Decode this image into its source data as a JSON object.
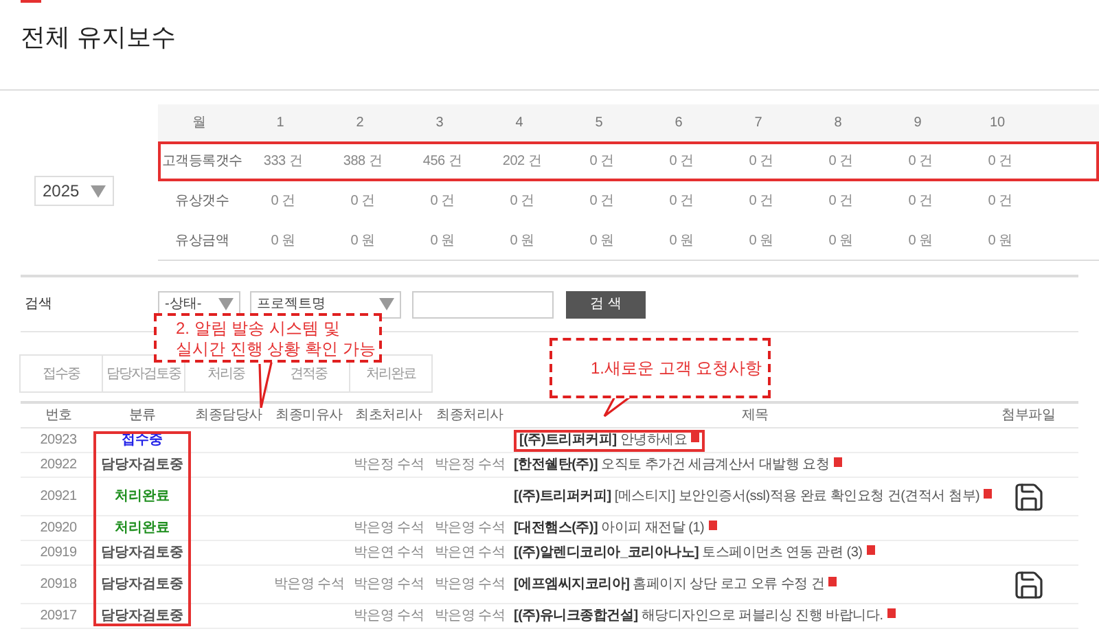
{
  "page_title": "전체 유지보수",
  "year_select": {
    "value": "2025"
  },
  "stats": {
    "header": [
      "월",
      "1",
      "2",
      "3",
      "4",
      "5",
      "6",
      "7",
      "8",
      "9",
      "10"
    ],
    "rows": [
      {
        "label": "고객등록갯수",
        "values": [
          "333 건",
          "388 건",
          "456 건",
          "202 건",
          "0 건",
          "0 건",
          "0 건",
          "0 건",
          "0 건",
          "0 건"
        ],
        "highlighted": true
      },
      {
        "label": "유상갯수",
        "values": [
          "0 건",
          "0 건",
          "0 건",
          "0 건",
          "0 건",
          "0 건",
          "0 건",
          "0 건",
          "0 건",
          "0 건"
        ],
        "highlighted": false
      },
      {
        "label": "유상금액",
        "values": [
          "0 원",
          "0 원",
          "0 원",
          "0 원",
          "0 원",
          "0 원",
          "0 원",
          "0 원",
          "0 원",
          "0 원"
        ],
        "highlighted": false
      }
    ]
  },
  "search": {
    "label": "검색",
    "status_select": "-상태-",
    "field_select": "프로젝트명",
    "button": "검 색"
  },
  "tabs": [
    {
      "label": "접수중",
      "selected": false
    },
    {
      "label": "담당자검토중",
      "selected": false
    },
    {
      "label": "처리중",
      "selected": false
    },
    {
      "label": "견적중",
      "selected": false
    },
    {
      "label": "처리완료",
      "selected": false
    }
  ],
  "table": {
    "columns": [
      {
        "label": "번호",
        "highlighted": false
      },
      {
        "label": "분류",
        "highlighted": true
      },
      {
        "label": "최종담당사",
        "highlighted": false
      },
      {
        "label": "최종미유사",
        "highlighted": false
      },
      {
        "label": "최초처리사",
        "highlighted": false
      },
      {
        "label": "최종처리사",
        "highlighted": false
      },
      {
        "label": "제목",
        "highlighted": false
      },
      {
        "label": "첨부파일",
        "highlighted": false
      }
    ],
    "rows": [
      {
        "number": "20923",
        "category": "접수중",
        "color": "#2323e8",
        "col_3": "",
        "col_4": "",
        "col_5": "",
        "col_6": "",
        "title_company": "[(주)트리퍼커피]",
        "title": "안녕하세요",
        "is_new": true,
        "attachment": false,
        "highlighted": true
      },
      {
        "number": "20922",
        "category": "담당자검토중",
        "color": "#555555",
        "col_3": "",
        "col_4": "",
        "col_5": "박은정 수석",
        "col_6": "박은정 수석",
        "title_company": "[한전쉘탄(주)]",
        "title": "오직토 추가건 세금계산서 대발행 요청",
        "is_new": true,
        "attachment": false,
        "highlighted": false
      },
      {
        "number": "20921",
        "category": "처리완료",
        "color": "#1f8f1f",
        "col_3": "",
        "col_4": "",
        "col_5": "",
        "col_6": "",
        "title_company": "[(주)트리퍼커피]",
        "title": "[메스티지] 보안인증서(ssl)적용 완료 확인요청 건(견적서 첨부)",
        "is_new": true,
        "attachment": true,
        "highlighted": false
      },
      {
        "number": "20920",
        "category": "처리완료",
        "color": "#1f8f1f",
        "col_3": "",
        "col_4": "",
        "col_5": "박은영 수석",
        "col_6": "박은영 수석",
        "title_company": "[대전햄스(주)]",
        "title": "아이피 재전달 (1)",
        "is_new": true,
        "attachment": false,
        "highlighted": false
      },
      {
        "number": "20919",
        "category": "담당자검토중",
        "color": "#555555",
        "col_3": "",
        "col_4": "",
        "col_5": "박은연 수석",
        "col_6": "박은연 수석",
        "title_company": "[(주)알렌디코리아_코리아나노]",
        "title": "토스페이먼츠 연동 관련 (3)",
        "is_new": true,
        "attachment": false,
        "highlighted": false
      },
      {
        "number": "20918",
        "category": "담당자검토중",
        "color": "#555555",
        "col_3": "",
        "col_4": "박은영 수석",
        "col_5": "박은영 수석",
        "col_6": "박은영 수석",
        "title_company": "[에프엠씨지코리아]",
        "title": "홈페이지 상단 로고 오류 수정 건",
        "is_new": true,
        "attachment": true,
        "highlighted": false
      },
      {
        "number": "20917",
        "category": "담당자검토중",
        "color": "#555555",
        "col_3": "",
        "col_4": "",
        "col_5": "박은영 수석",
        "col_6": "박은영 수석",
        "title_company": "[(주)유니크종합건설]",
        "title": "해당디자인으로 퍼블리싱 진행 바랍니다.",
        "is_new": true,
        "attachment": false,
        "highlighted": false
      }
    ]
  },
  "callouts": [
    {
      "lines": [
        "2. 알림 발송 시스템 및",
        "실시간 진행 상황 확인 가능"
      ]
    },
    {
      "lines": [
        "1.새로운 고객 요청사항"
      ]
    }
  ]
}
